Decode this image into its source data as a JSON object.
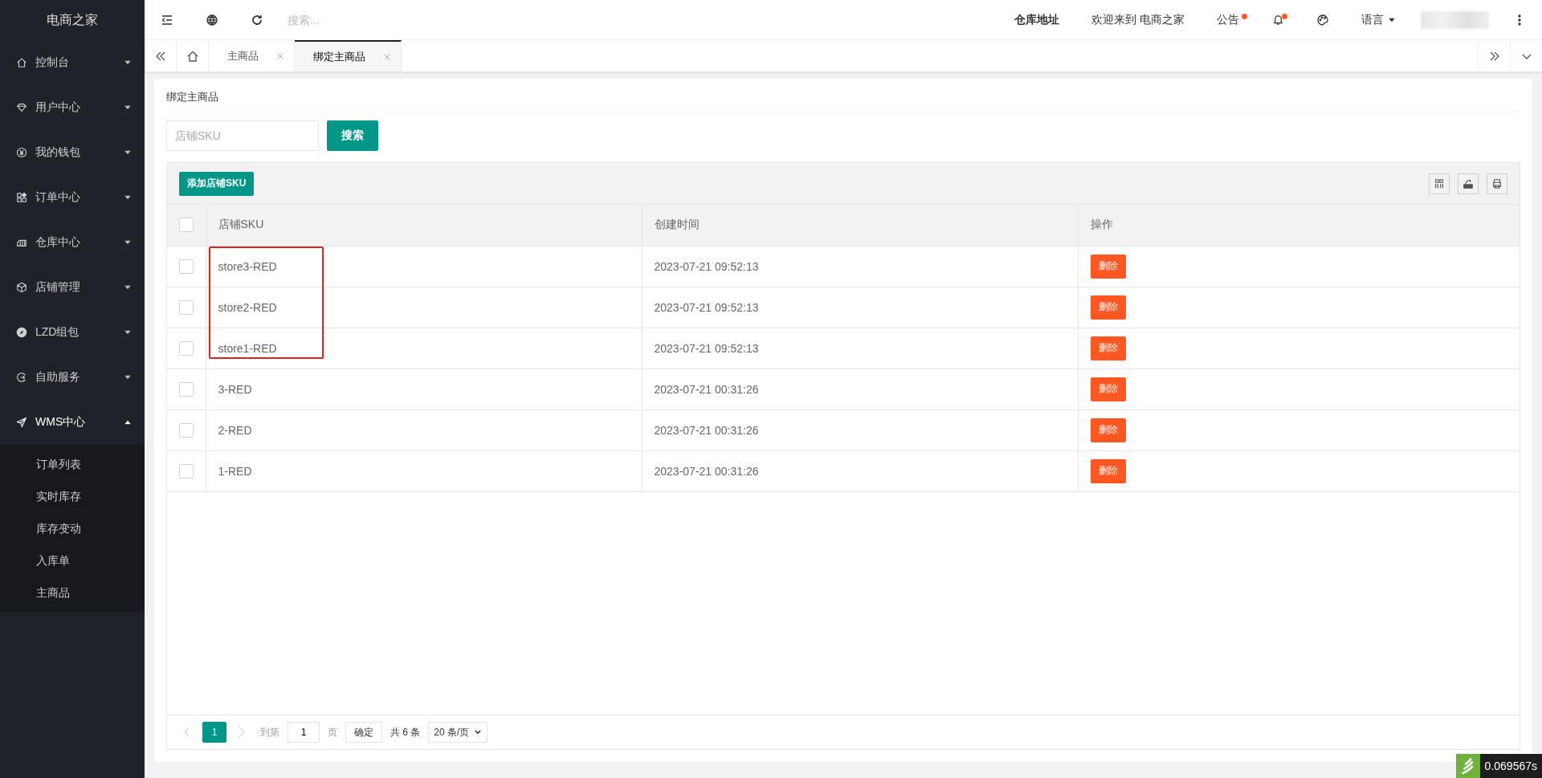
{
  "sidebar": {
    "logo": "电商之家",
    "items": [
      {
        "label": "控制台",
        "expanded": false
      },
      {
        "label": "用户中心",
        "expanded": false
      },
      {
        "label": "我的钱包",
        "expanded": false
      },
      {
        "label": "订单中心",
        "expanded": false
      },
      {
        "label": "仓库中心",
        "expanded": false
      },
      {
        "label": "店铺管理",
        "expanded": false
      },
      {
        "label": "LZD组包",
        "expanded": false
      },
      {
        "label": "自助服务",
        "expanded": false
      },
      {
        "label": "WMS中心",
        "expanded": true,
        "children": [
          {
            "label": "订单列表"
          },
          {
            "label": "实时库存"
          },
          {
            "label": "库存变动"
          },
          {
            "label": "入库单"
          },
          {
            "label": "主商品"
          }
        ]
      }
    ]
  },
  "header": {
    "search": {
      "placeholder": "搜索..."
    },
    "warehouse": "仓库地址",
    "welcome": "欢迎来到 电商之家",
    "notice": "公告",
    "language": "语言"
  },
  "tabs": [
    {
      "label": "主商品",
      "selected": false
    },
    {
      "label": "绑定主商品",
      "selected": true
    }
  ],
  "page": {
    "title": "绑定主商品",
    "filter": {
      "placeholder": "店铺SKU"
    },
    "search_button": "搜索",
    "add_button": "添加店铺SKU",
    "table": {
      "select_all_checked": false,
      "columns": [
        "店铺SKU",
        "创建时间",
        "操作"
      ],
      "rows": [
        {
          "sku": "store3-RED",
          "created": "2023-07-21 09:52:13",
          "action": "删除",
          "checked": false
        },
        {
          "sku": "store2-RED",
          "created": "2023-07-21 09:52:13",
          "action": "删除",
          "checked": false
        },
        {
          "sku": "store1-RED",
          "created": "2023-07-21 09:52:13",
          "action": "删除",
          "checked": false
        },
        {
          "sku": "3-RED",
          "created": "2023-07-21 00:31:26",
          "action": "删除",
          "checked": false
        },
        {
          "sku": "2-RED",
          "created": "2023-07-21 00:31:26",
          "action": "删除",
          "checked": false
        },
        {
          "sku": "1-RED",
          "created": "2023-07-21 00:31:26",
          "action": "删除",
          "checked": false
        }
      ]
    },
    "pagination": {
      "pages": [
        {
          "label": "1",
          "selected": true
        }
      ],
      "goto": "到第",
      "page_value": "1",
      "page_unit": "页",
      "confirm": "确定",
      "total": "共 6 条",
      "page_size": "20 条/页"
    }
  },
  "timer": "0.069567s"
}
